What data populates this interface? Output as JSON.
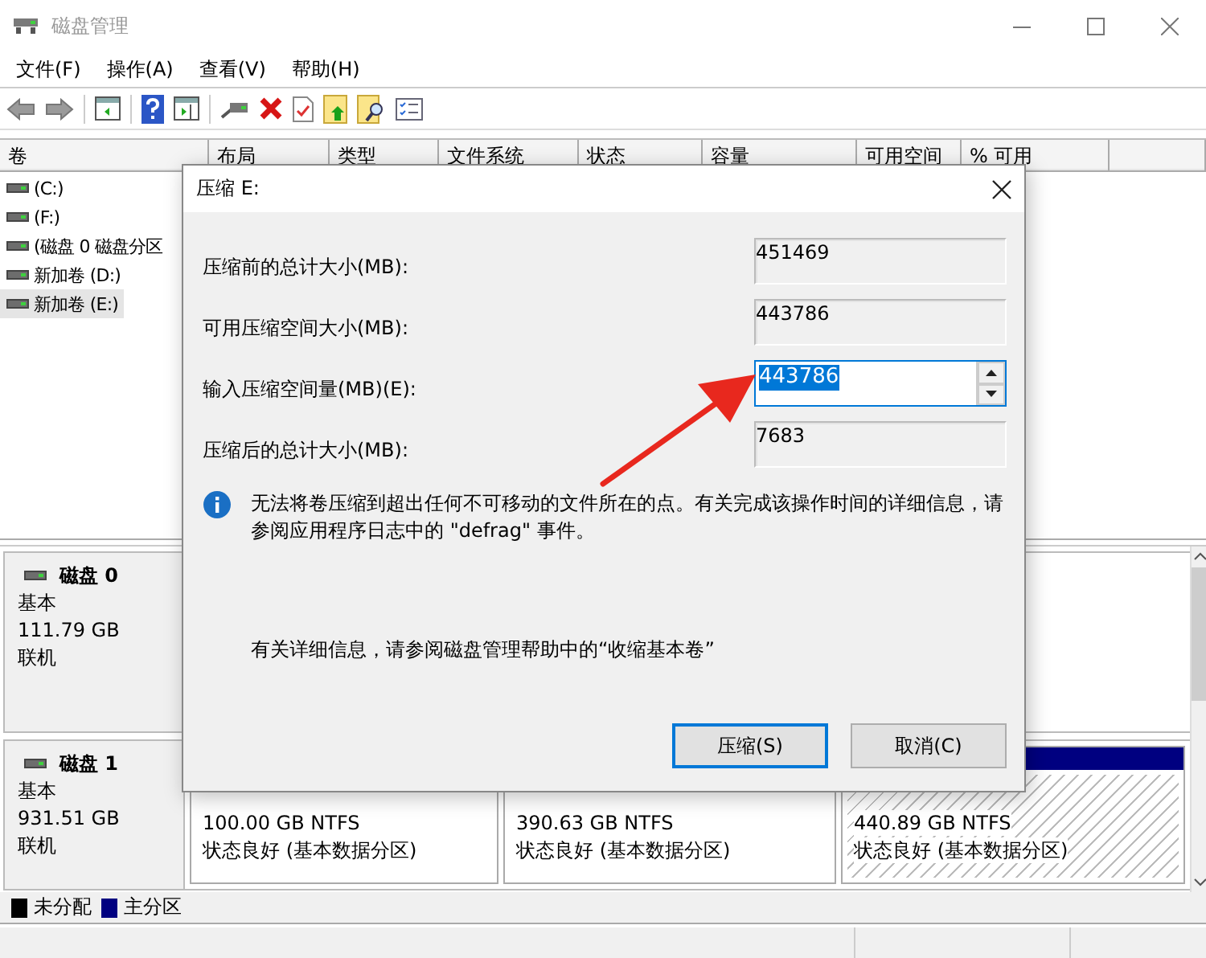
{
  "window": {
    "title": "磁盘管理"
  },
  "menu": [
    "文件(F)",
    "操作(A)",
    "查看(V)",
    "帮助(H)"
  ],
  "volume_table": {
    "columns": [
      "卷",
      "布局",
      "类型",
      "文件系统",
      "状态",
      "容量",
      "可用空间",
      "% 可用"
    ],
    "rows": [
      {
        "name": "(C:)",
        "selected": false
      },
      {
        "name": "(F:)",
        "selected": false
      },
      {
        "name": "(磁盘 0 磁盘分区",
        "selected": false
      },
      {
        "name": "新加卷 (D:)",
        "selected": false
      },
      {
        "name": "新加卷 (E:)",
        "selected": true
      }
    ]
  },
  "disks": [
    {
      "name": "磁盘 0",
      "type": "基本",
      "size": "111.79 GB",
      "status": "联机"
    },
    {
      "name": "磁盘 1",
      "type": "基本",
      "size": "931.51 GB",
      "status": "联机",
      "partitions": [
        {
          "size": "100.00 GB NTFS",
          "status": "状态良好 (基本数据分区)",
          "selected": false
        },
        {
          "size": "390.63 GB NTFS",
          "status": "状态良好 (基本数据分区)",
          "selected": false
        },
        {
          "size": "440.89 GB NTFS",
          "status": "状态良好 (基本数据分区)",
          "selected": true
        }
      ]
    }
  ],
  "legend": [
    {
      "label": "未分配",
      "color": "#000000"
    },
    {
      "label": "主分区",
      "color": "#000080"
    }
  ],
  "dialog": {
    "title": "压缩 E:",
    "fields": [
      {
        "label": "压缩前的总计大小(MB):",
        "value": "451469",
        "kind": "readonly"
      },
      {
        "label": "可用压缩空间大小(MB):",
        "value": "443786",
        "kind": "readonly"
      },
      {
        "label": "输入压缩空间量(MB)(E):",
        "value": "443786",
        "kind": "spin",
        "value_selected": true
      },
      {
        "label": "压缩后的总计大小(MB):",
        "value": "7683",
        "kind": "readonly"
      }
    ],
    "info": "无法将卷压缩到超出任何不可移动的文件所在的点。有关完成该操作时间的详细信息，请参阅应用程序日志中的 \"defrag\" 事件。",
    "help": "有关详细信息，请参阅磁盘管理帮助中的“收缩基本卷”",
    "buttons": [
      {
        "label": "压缩(S)",
        "default": true
      },
      {
        "label": "取消(C)",
        "default": false
      }
    ]
  }
}
